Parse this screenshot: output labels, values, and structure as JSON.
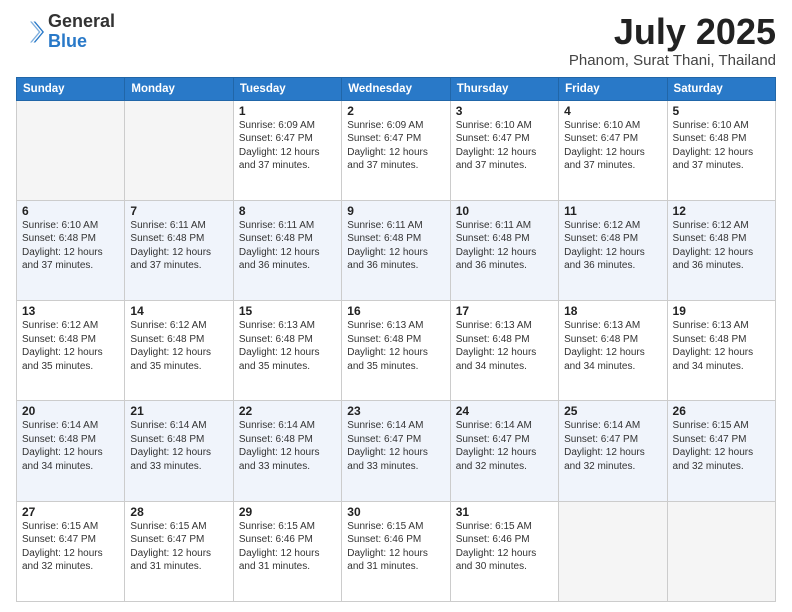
{
  "header": {
    "logo_general": "General",
    "logo_blue": "Blue",
    "month": "July 2025",
    "location": "Phanom, Surat Thani, Thailand"
  },
  "weekdays": [
    "Sunday",
    "Monday",
    "Tuesday",
    "Wednesday",
    "Thursday",
    "Friday",
    "Saturday"
  ],
  "weeks": [
    [
      {
        "day": "",
        "info": ""
      },
      {
        "day": "",
        "info": ""
      },
      {
        "day": "1",
        "info": "Sunrise: 6:09 AM\nSunset: 6:47 PM\nDaylight: 12 hours and 37 minutes."
      },
      {
        "day": "2",
        "info": "Sunrise: 6:09 AM\nSunset: 6:47 PM\nDaylight: 12 hours and 37 minutes."
      },
      {
        "day": "3",
        "info": "Sunrise: 6:10 AM\nSunset: 6:47 PM\nDaylight: 12 hours and 37 minutes."
      },
      {
        "day": "4",
        "info": "Sunrise: 6:10 AM\nSunset: 6:47 PM\nDaylight: 12 hours and 37 minutes."
      },
      {
        "day": "5",
        "info": "Sunrise: 6:10 AM\nSunset: 6:48 PM\nDaylight: 12 hours and 37 minutes."
      }
    ],
    [
      {
        "day": "6",
        "info": "Sunrise: 6:10 AM\nSunset: 6:48 PM\nDaylight: 12 hours and 37 minutes."
      },
      {
        "day": "7",
        "info": "Sunrise: 6:11 AM\nSunset: 6:48 PM\nDaylight: 12 hours and 37 minutes."
      },
      {
        "day": "8",
        "info": "Sunrise: 6:11 AM\nSunset: 6:48 PM\nDaylight: 12 hours and 36 minutes."
      },
      {
        "day": "9",
        "info": "Sunrise: 6:11 AM\nSunset: 6:48 PM\nDaylight: 12 hours and 36 minutes."
      },
      {
        "day": "10",
        "info": "Sunrise: 6:11 AM\nSunset: 6:48 PM\nDaylight: 12 hours and 36 minutes."
      },
      {
        "day": "11",
        "info": "Sunrise: 6:12 AM\nSunset: 6:48 PM\nDaylight: 12 hours and 36 minutes."
      },
      {
        "day": "12",
        "info": "Sunrise: 6:12 AM\nSunset: 6:48 PM\nDaylight: 12 hours and 36 minutes."
      }
    ],
    [
      {
        "day": "13",
        "info": "Sunrise: 6:12 AM\nSunset: 6:48 PM\nDaylight: 12 hours and 35 minutes."
      },
      {
        "day": "14",
        "info": "Sunrise: 6:12 AM\nSunset: 6:48 PM\nDaylight: 12 hours and 35 minutes."
      },
      {
        "day": "15",
        "info": "Sunrise: 6:13 AM\nSunset: 6:48 PM\nDaylight: 12 hours and 35 minutes."
      },
      {
        "day": "16",
        "info": "Sunrise: 6:13 AM\nSunset: 6:48 PM\nDaylight: 12 hours and 35 minutes."
      },
      {
        "day": "17",
        "info": "Sunrise: 6:13 AM\nSunset: 6:48 PM\nDaylight: 12 hours and 34 minutes."
      },
      {
        "day": "18",
        "info": "Sunrise: 6:13 AM\nSunset: 6:48 PM\nDaylight: 12 hours and 34 minutes."
      },
      {
        "day": "19",
        "info": "Sunrise: 6:13 AM\nSunset: 6:48 PM\nDaylight: 12 hours and 34 minutes."
      }
    ],
    [
      {
        "day": "20",
        "info": "Sunrise: 6:14 AM\nSunset: 6:48 PM\nDaylight: 12 hours and 34 minutes."
      },
      {
        "day": "21",
        "info": "Sunrise: 6:14 AM\nSunset: 6:48 PM\nDaylight: 12 hours and 33 minutes."
      },
      {
        "day": "22",
        "info": "Sunrise: 6:14 AM\nSunset: 6:48 PM\nDaylight: 12 hours and 33 minutes."
      },
      {
        "day": "23",
        "info": "Sunrise: 6:14 AM\nSunset: 6:47 PM\nDaylight: 12 hours and 33 minutes."
      },
      {
        "day": "24",
        "info": "Sunrise: 6:14 AM\nSunset: 6:47 PM\nDaylight: 12 hours and 32 minutes."
      },
      {
        "day": "25",
        "info": "Sunrise: 6:14 AM\nSunset: 6:47 PM\nDaylight: 12 hours and 32 minutes."
      },
      {
        "day": "26",
        "info": "Sunrise: 6:15 AM\nSunset: 6:47 PM\nDaylight: 12 hours and 32 minutes."
      }
    ],
    [
      {
        "day": "27",
        "info": "Sunrise: 6:15 AM\nSunset: 6:47 PM\nDaylight: 12 hours and 32 minutes."
      },
      {
        "day": "28",
        "info": "Sunrise: 6:15 AM\nSunset: 6:47 PM\nDaylight: 12 hours and 31 minutes."
      },
      {
        "day": "29",
        "info": "Sunrise: 6:15 AM\nSunset: 6:46 PM\nDaylight: 12 hours and 31 minutes."
      },
      {
        "day": "30",
        "info": "Sunrise: 6:15 AM\nSunset: 6:46 PM\nDaylight: 12 hours and 31 minutes."
      },
      {
        "day": "31",
        "info": "Sunrise: 6:15 AM\nSunset: 6:46 PM\nDaylight: 12 hours and 30 minutes."
      },
      {
        "day": "",
        "info": ""
      },
      {
        "day": "",
        "info": ""
      }
    ]
  ]
}
